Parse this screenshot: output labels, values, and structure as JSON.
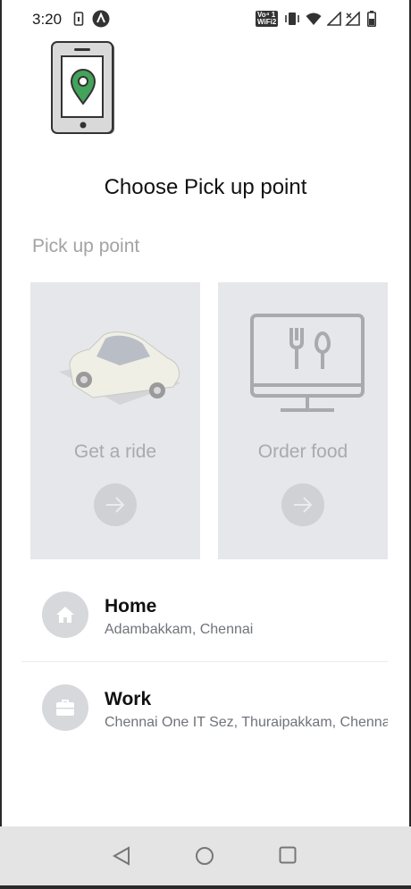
{
  "status_bar": {
    "time": "3:20",
    "left_icons": [
      "sim-status-icon",
      "app-notification-icon"
    ],
    "right_icons": [
      "volte-wifi-icon",
      "vibrate-icon",
      "wifi-icon",
      "signal-icon",
      "signal-no-data-icon",
      "battery-icon"
    ],
    "volte_text": "Vo⁴ 1",
    "wifi_call_text": "WiFi2"
  },
  "header": {
    "illustration": "phone-location-icon",
    "title": "Choose Pick up point"
  },
  "pickup": {
    "section_label": "Pick up point",
    "cards": [
      {
        "label": "Get a ride",
        "icon": "car-icon",
        "action_icon": "arrow-right-icon"
      },
      {
        "label": "Order food",
        "icon": "monitor-food-icon",
        "action_icon": "arrow-right-icon"
      }
    ]
  },
  "places": [
    {
      "title": "Home",
      "address": "Adambakkam, Chennai",
      "icon": "home-icon"
    },
    {
      "title": "Work",
      "address": "Chennai One IT Sez, Thuraipakkam, Chennai",
      "icon": "briefcase-icon"
    }
  ],
  "nav_bar": {
    "buttons": [
      "back-icon",
      "home-nav-icon",
      "recents-icon"
    ]
  },
  "colors": {
    "card_bg": "#e6e7ea",
    "pin_green": "#4caf50",
    "muted_text": "#a3a3a3",
    "nav_bg": "#e4e4e4"
  }
}
